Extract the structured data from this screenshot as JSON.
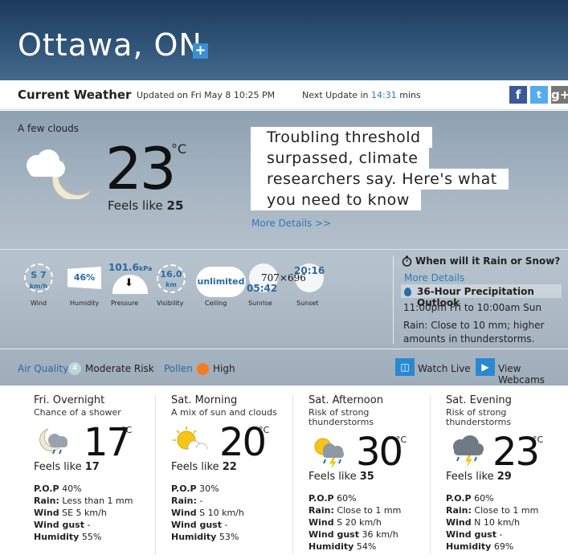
{
  "header": {
    "city": "Ottawa, ON",
    "add_icon": "plus-icon"
  },
  "current_bar": {
    "title": "Current Weather",
    "updated": "Updated on Fri May 8 10:25 PM",
    "next_update_prefix": "Next Update in",
    "next_update_value": "14:31",
    "next_update_suffix": "mins",
    "social": [
      "facebook-icon",
      "twitter-icon",
      "google-plus-icon"
    ]
  },
  "current": {
    "condition": "A few clouds",
    "temp": "23",
    "unit": "°C",
    "feels_label": "Feels like",
    "feels_value": "25",
    "more_details": "More Details >>",
    "overlay_lines": [
      "Troubling threshold",
      "surpassed, climate",
      "researchers say. Here's what",
      "you need to know"
    ]
  },
  "metrics": {
    "wind_value": "S 7",
    "wind_unit": "km/h",
    "wind_label": "Wind",
    "humidity_value": "46%",
    "humidity_label": "Humidity",
    "pressure_value": "101.6",
    "pressure_unit": "kPa",
    "pressure_label": "Pressure",
    "visibility_value": "16.0",
    "visibility_unit": "km",
    "visibility_label": "Visibility",
    "ceiling_value": "unlimited",
    "ceiling_label": "Ceiling",
    "sunrise_value": "05:42",
    "sunrise_label": "Sunrise",
    "sunset_value": "20:16",
    "sunset_label": "Sunset",
    "dims_text": "707×696"
  },
  "rain": {
    "question": "When will it Rain or Snow?",
    "more": "More Details",
    "outlook_title": "36-Hour Precipitation Outlook",
    "outlook_time": "11:00pm Fri to 10:00am Sun",
    "outlook_text": "Rain: Close to 10 mm; higher amounts in thunderstorms."
  },
  "extras": {
    "air_quality_label": "Air Quality",
    "air_quality_num": "4",
    "air_quality_risk": "Moderate Risk",
    "pollen_label": "Pollen",
    "pollen_value": "High",
    "pollen_color": "#f47c20",
    "watch_live": "Watch Live",
    "webcams": "View Webcams"
  },
  "forecast": [
    {
      "period": "Fri. Overnight",
      "desc": "Chance of a shower",
      "icon": "moon-cloud-rain-icon",
      "temp": "17",
      "feels": "17",
      "pop": "40%",
      "rain": "Less than 1 mm",
      "wind": "SE 5 km/h",
      "gust": "-",
      "humidity": "55%"
    },
    {
      "period": "Sat. Morning",
      "desc": "A mix of sun and clouds",
      "icon": "sun-cloud-icon",
      "temp": "20",
      "feels": "22",
      "pop": "30%",
      "rain": "-",
      "wind": "S 10 km/h",
      "gust": "-",
      "humidity": "53%"
    },
    {
      "period": "Sat. Afternoon",
      "desc": "Risk of strong thunderstorms",
      "icon": "sun-thunderstorm-icon",
      "temp": "30",
      "feels": "35",
      "pop": "60%",
      "rain": "Close to 1 mm",
      "wind": "S 20 km/h",
      "gust": "36 km/h",
      "humidity": "54%"
    },
    {
      "period": "Sat. Evening",
      "desc": "Risk of strong thunderstorms",
      "icon": "cloud-thunderstorm-icon",
      "temp": "23",
      "feels": "29",
      "pop": "60%",
      "rain": "Close to 1 mm",
      "wind": "N 10 km/h",
      "gust": "-",
      "humidity": "69%"
    }
  ],
  "forecast_labels": {
    "unit": "°C",
    "feels": "Feels like",
    "pop": "P.O.P",
    "rain": "Rain:",
    "wind": "Wind",
    "gust": "Wind gust",
    "humidity": "Humidity"
  }
}
